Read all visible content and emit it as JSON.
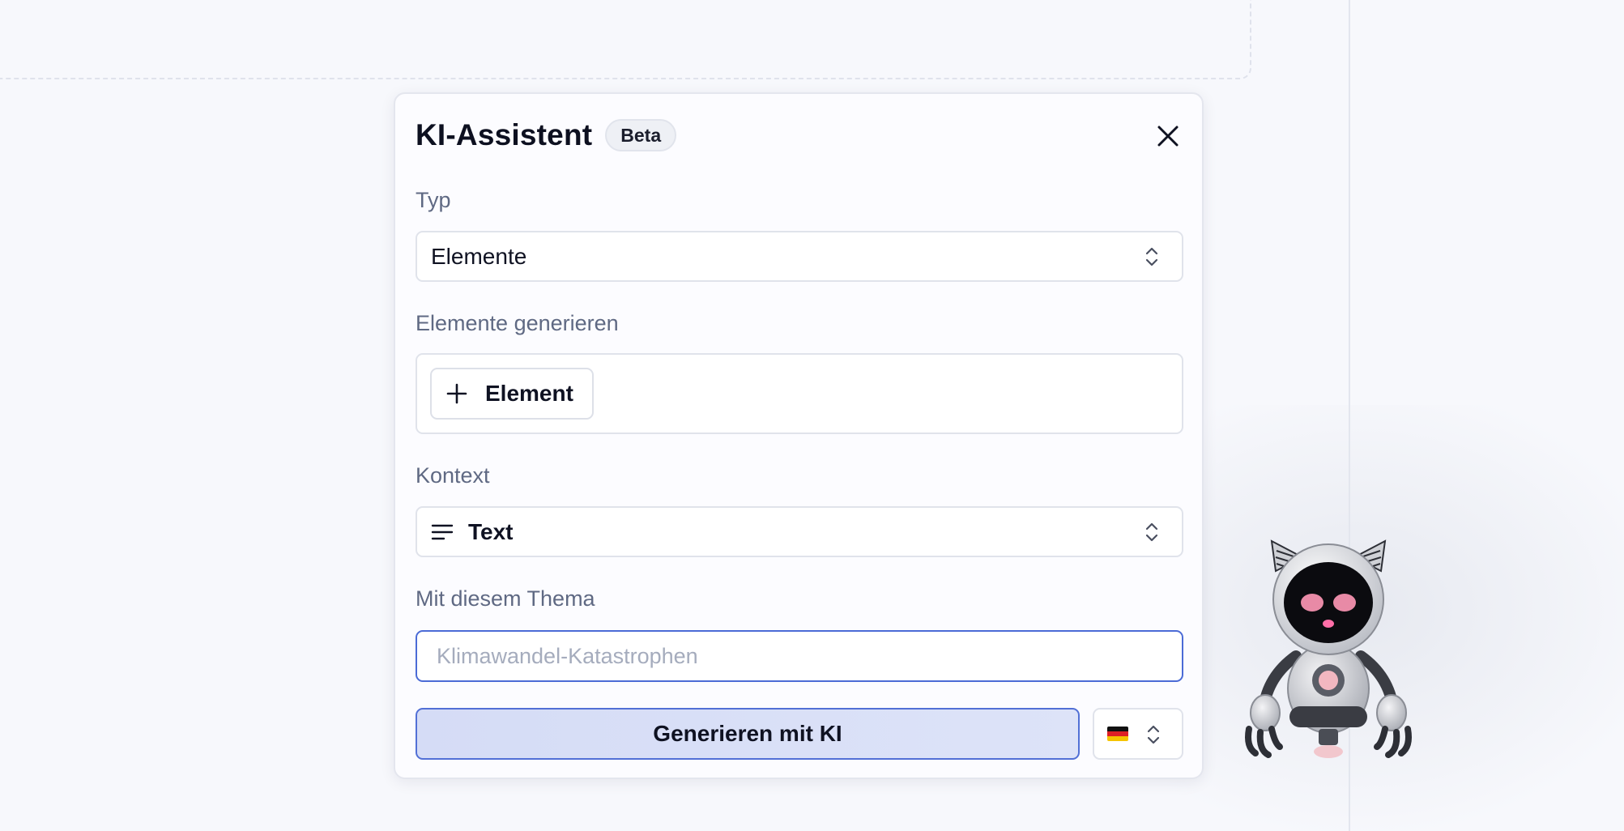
{
  "panel": {
    "title": "KI-Assistent",
    "badge": "Beta",
    "close_icon": "close-icon"
  },
  "type_field": {
    "label": "Typ",
    "value": "Elemente",
    "icon": "chevron-up-down-icon"
  },
  "elements_field": {
    "label": "Elemente generieren",
    "add_button_label": "Element",
    "add_icon": "plus-icon"
  },
  "context_field": {
    "label": "Kontext",
    "value": "Text",
    "icon": "text-lines-icon"
  },
  "topic_field": {
    "label": "Mit diesem Thema",
    "placeholder": "Klimawandel-Katastrophen",
    "value": ""
  },
  "actions": {
    "generate_label": "Generieren mit KI",
    "language_icon": "german-flag-icon"
  },
  "colors": {
    "accent": "#4b6bd6",
    "generate_bg": "#d5dcf6",
    "background": "#f7f8fc"
  }
}
